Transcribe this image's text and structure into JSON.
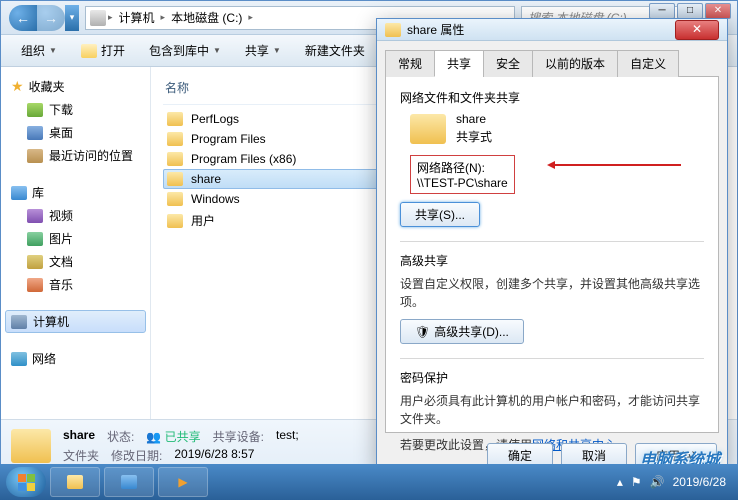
{
  "breadcrumb": {
    "seg1": "计算机",
    "seg2": "本地磁盘 (C:)"
  },
  "search": {
    "placeholder": "搜索 本地磁盘 (C:)"
  },
  "toolbar": {
    "organize": "组织",
    "open": "打开",
    "include": "包含到库中",
    "share": "共享",
    "newfolder": "新建文件夹"
  },
  "sidebar": {
    "favorites": "收藏夹",
    "downloads": "下载",
    "desktop": "桌面",
    "recent": "最近访问的位置",
    "libraries": "库",
    "videos": "视频",
    "pictures": "图片",
    "documents": "文档",
    "music": "音乐",
    "computer": "计算机",
    "network": "网络"
  },
  "columns": {
    "name": "名称"
  },
  "files": {
    "f0": "PerfLogs",
    "f1": "Program Files",
    "f2": "Program Files (x86)",
    "f3": "share",
    "f4": "Windows",
    "f5": "用户"
  },
  "details": {
    "name": "share",
    "status_label": "状态:",
    "status_value": "已共享",
    "type_label": "文件夹",
    "date_label": "修改日期:",
    "date_value": "2019/6/28 8:57",
    "device_label": "共享设备:",
    "device_value": "test;"
  },
  "dialog": {
    "title": "share 属性",
    "tabs": {
      "t0": "常规",
      "t1": "共享",
      "t2": "安全",
      "t3": "以前的版本",
      "t4": "自定义"
    },
    "section1_title": "网络文件和文件夹共享",
    "share_name": "share",
    "share_mode": "共享式",
    "netpath_label": "网络路径(N):",
    "netpath_value": "\\\\TEST-PC\\share",
    "share_btn": "共享(S)...",
    "section2_title": "高级共享",
    "section2_desc": "设置自定义权限，创建多个共享，并设置其他高级共享选项。",
    "adv_btn": "高级共享(D)...",
    "section3_title": "密码保护",
    "section3_desc": "用户必须具有此计算机的用户帐户和密码，才能访问共享文件夹。",
    "section3_desc2a": "若要更改此设置，请使用",
    "section3_link": "网络和共享中心",
    "ok": "确定",
    "cancel": "取消",
    "apply": "应用(A)"
  },
  "tray": {
    "time": "2019/6/28"
  },
  "watermark": "电脑系统城"
}
